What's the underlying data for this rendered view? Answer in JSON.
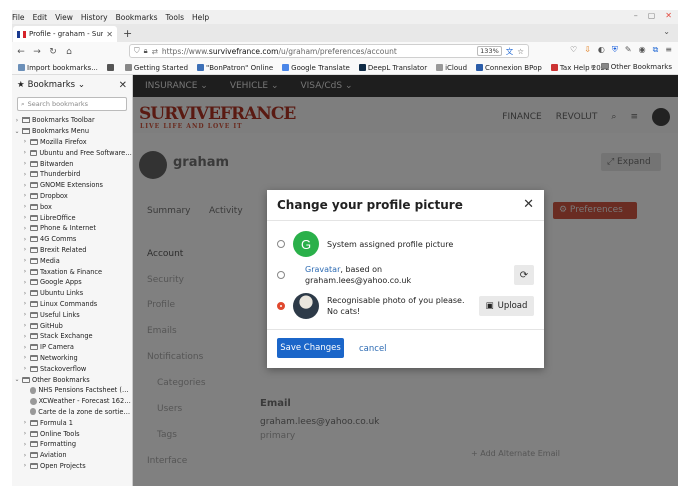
{
  "menubar": [
    "File",
    "Edit",
    "View",
    "History",
    "Bookmarks",
    "Tools",
    "Help"
  ],
  "window_controls": [
    "–",
    "▢",
    "✕"
  ],
  "tab": {
    "title": "Profile - graham - Survive",
    "close": "✕",
    "new": "+"
  },
  "tab_overflow": "⌄",
  "nav": {
    "url_prefix": "https://www.",
    "url_domain": "survivefrance.com",
    "url_path": "/u/graham/preferences/account",
    "zoom": "133%"
  },
  "bookmarks_toolbar": [
    {
      "label": "Import bookmarks...",
      "color": "#6b8fb8"
    },
    {
      "label": "",
      "color": "#555555"
    },
    {
      "label": "Getting Started",
      "color": "#888888"
    },
    {
      "label": "\"BonPatron\" Online",
      "color": "#3c6fb6"
    },
    {
      "label": "Google Translate",
      "color": "#4a86e8"
    },
    {
      "label": "DeepL Translator",
      "color": "#0f2b46"
    },
    {
      "label": "iCloud",
      "color": "#999999"
    },
    {
      "label": "Connexion BPop",
      "color": "#2a5ca8"
    },
    {
      "label": "Tax Help 2022",
      "color": "#cc3333"
    }
  ],
  "bookmarks_overflow": "»",
  "other_bookmarks": "Other Bookmarks",
  "sidebar": {
    "title": "Bookmarks",
    "close": "✕",
    "search_placeholder": "Search bookmarks",
    "items": [
      {
        "label": "Bookmarks Toolbar",
        "depth": 0,
        "kind": "root",
        "arrow": "›"
      },
      {
        "label": "Bookmarks Menu",
        "depth": 0,
        "kind": "root",
        "arrow": "⌄"
      },
      {
        "label": "Mozilla Firefox",
        "depth": 1,
        "kind": "folder",
        "arrow": "›"
      },
      {
        "label": "Ubuntu and Free Software li...",
        "depth": 1,
        "kind": "folder",
        "arrow": "›"
      },
      {
        "label": "Bitwarden",
        "depth": 1,
        "kind": "folder",
        "arrow": "›"
      },
      {
        "label": "Thunderbird",
        "depth": 1,
        "kind": "folder",
        "arrow": "›"
      },
      {
        "label": "GNOME Extensions",
        "depth": 1,
        "kind": "folder",
        "arrow": "›"
      },
      {
        "label": "Dropbox",
        "depth": 1,
        "kind": "folder",
        "arrow": "›"
      },
      {
        "label": "box",
        "depth": 1,
        "kind": "folder",
        "arrow": "›"
      },
      {
        "label": "LibreOffice",
        "depth": 1,
        "kind": "folder",
        "arrow": "›"
      },
      {
        "label": "Phone & Internet",
        "depth": 1,
        "kind": "folder",
        "arrow": "›"
      },
      {
        "label": "4G Comms",
        "depth": 1,
        "kind": "folder",
        "arrow": "›"
      },
      {
        "label": "Brexit Related",
        "depth": 1,
        "kind": "folder",
        "arrow": "›"
      },
      {
        "label": "Media",
        "depth": 1,
        "kind": "folder",
        "arrow": "›"
      },
      {
        "label": "Taxation & Finance",
        "depth": 1,
        "kind": "folder",
        "arrow": "›"
      },
      {
        "label": "Google Apps",
        "depth": 1,
        "kind": "folder",
        "arrow": "›"
      },
      {
        "label": "Ubuntu Links",
        "depth": 1,
        "kind": "folder",
        "arrow": "›"
      },
      {
        "label": "Linux Commands",
        "depth": 1,
        "kind": "folder",
        "arrow": "›"
      },
      {
        "label": "Useful Links",
        "depth": 1,
        "kind": "folder",
        "arrow": "›"
      },
      {
        "label": "GitHub",
        "depth": 1,
        "kind": "folder",
        "arrow": "›"
      },
      {
        "label": "Stack Exchange",
        "depth": 1,
        "kind": "folder",
        "arrow": "›"
      },
      {
        "label": "IP Camera",
        "depth": 1,
        "kind": "folder",
        "arrow": "›"
      },
      {
        "label": "Networking",
        "depth": 1,
        "kind": "folder",
        "arrow": "›"
      },
      {
        "label": "Stackoverflow",
        "depth": 1,
        "kind": "folder",
        "arrow": "›"
      },
      {
        "label": "Other Bookmarks",
        "depth": 0,
        "kind": "folder",
        "arrow": "⌄"
      },
      {
        "label": "NHS Pensions Factsheet (V2...",
        "depth": 1,
        "kind": "link",
        "arrow": ""
      },
      {
        "label": "XCWeather - Forecast 1626...",
        "depth": 1,
        "kind": "link",
        "arrow": ""
      },
      {
        "label": "Carte de la zone de sortie 1 ...",
        "depth": 1,
        "kind": "link",
        "arrow": ""
      },
      {
        "label": "Formula 1",
        "depth": 1,
        "kind": "folder",
        "arrow": "›"
      },
      {
        "label": "Online Tools",
        "depth": 1,
        "kind": "folder",
        "arrow": "›"
      },
      {
        "label": "Formatting",
        "depth": 1,
        "kind": "folder",
        "arrow": "›"
      },
      {
        "label": "Aviation",
        "depth": 1,
        "kind": "folder",
        "arrow": "›"
      },
      {
        "label": "Open Projects",
        "depth": 1,
        "kind": "folder",
        "arrow": "›"
      }
    ]
  },
  "site": {
    "nav": [
      "INSURANCE ⌄",
      "VEHICLE ⌄",
      "VISA/CdS ⌄"
    ],
    "logo": "SURVIVEFRANCE",
    "tagline": "LIVE LIFE AND LOVE IT",
    "right": [
      "FINANCE",
      "REVOLUT"
    ],
    "username": "graham",
    "expand": "⤢ Expand",
    "tabs": [
      "Summary",
      "Activity"
    ],
    "preferences_btn": "⚙ Preferences",
    "sidenav": [
      "Account",
      "Security",
      "Profile",
      "Emails",
      "Notifications",
      "Categories",
      "Users",
      "Tags",
      "Interface"
    ],
    "email_heading": "Email",
    "email_value": "graham.lees@yahoo.co.uk",
    "email_primary": "primary",
    "add_email": "+ Add Alternate Email"
  },
  "modal": {
    "title": "Change your profile picture",
    "close": "✕",
    "options": [
      {
        "avatar_letter": "G",
        "text": "System assigned profile picture"
      },
      {
        "link": "Gravatar",
        "text_after": ", based on",
        "text_line2": "graham.lees@yahoo.co.uk"
      },
      {
        "text": "Recognisable photo of you please. No cats!"
      }
    ],
    "upload_label": "Upload",
    "save_label": "Save Changes",
    "cancel_label": "cancel"
  },
  "colors": {
    "accent": "#1b66c9",
    "radio_selected": "#e0492f",
    "gravatar_green": "#2ab04a",
    "preferences_red": "#c43a28"
  }
}
